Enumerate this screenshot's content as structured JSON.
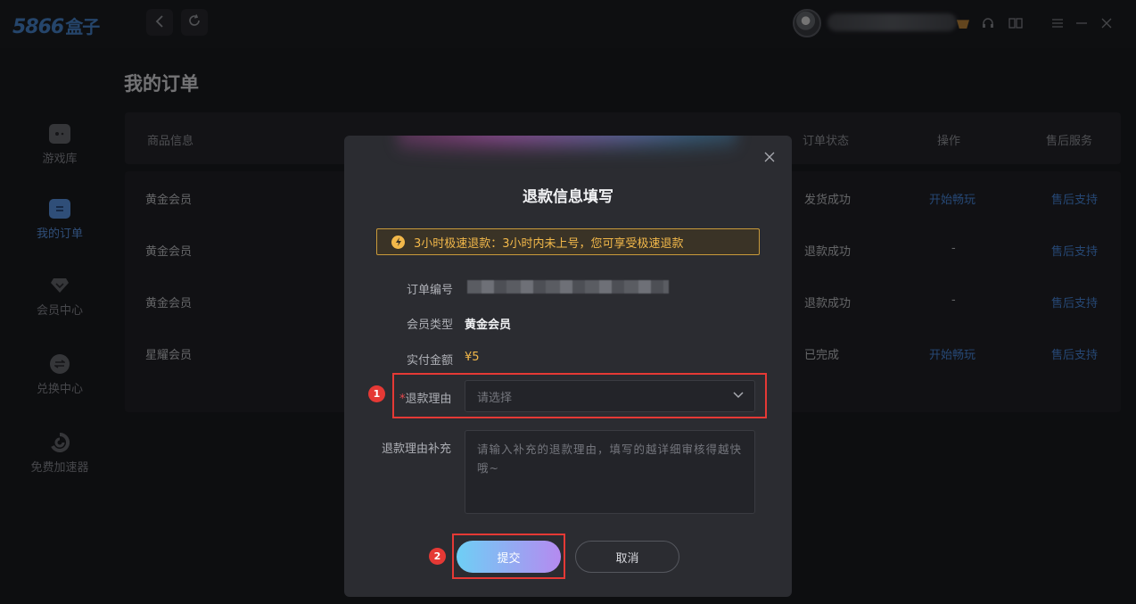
{
  "app": {
    "logo_text": "5866",
    "logo_suffix": "盒子",
    "back_icon": "chevron-left-icon",
    "refresh_icon": "refresh-icon"
  },
  "titlebar": {
    "icons": [
      "vip-icon",
      "headset-icon",
      "book-icon",
      "menu-icon",
      "minimize-icon",
      "close-icon"
    ]
  },
  "sidebar": {
    "items": [
      {
        "label": "游戏库",
        "icon": "gamepad-icon",
        "active": false
      },
      {
        "label": "我的订单",
        "icon": "orders-icon",
        "active": true
      },
      {
        "label": "会员中心",
        "icon": "diamond-icon",
        "active": false
      },
      {
        "label": "兑换中心",
        "icon": "exchange-icon",
        "active": false
      },
      {
        "label": "免费加速器",
        "icon": "accelerator-icon",
        "active": false
      }
    ]
  },
  "page": {
    "title": "我的订单"
  },
  "table": {
    "headers": {
      "product": "商品信息",
      "status": "订单状态",
      "action": "操作",
      "service": "售后服务"
    },
    "rows": [
      {
        "product": "黄金会员",
        "status": "发货成功",
        "action": "开始畅玩",
        "service": "售后支持"
      },
      {
        "product": "黄金会员",
        "status": "退款成功",
        "action": "-",
        "service": "售后支持"
      },
      {
        "product": "黄金会员",
        "status": "退款成功",
        "action": "-",
        "service": "售后支持"
      },
      {
        "product": "星耀会员",
        "status": "已完成",
        "action": "开始畅玩",
        "service": "售后支持"
      }
    ]
  },
  "modal": {
    "title": "退款信息填写",
    "close_icon": "close-icon",
    "notice": "3小时极速退款：3小时内未上号，您可享受极速退款",
    "fields": {
      "order_no_label": "订单编号",
      "member_type_label": "会员类型",
      "member_type_value": "黄金会员",
      "amount_label": "实付金额",
      "amount_value": "¥5",
      "reason_required_mark": "*",
      "reason_label": "退款理由",
      "reason_placeholder": "请选择",
      "supplement_label": "退款理由补充",
      "supplement_placeholder": "请输入补充的退款理由，填写的越详细审核得越快哦~"
    },
    "submit_label": "提交",
    "cancel_label": "取消"
  },
  "annotations": {
    "step1": "1",
    "step2": "2"
  },
  "colors": {
    "accent": "#4c8fe8",
    "warning": "#f2b84a",
    "annotation": "#e53935"
  }
}
